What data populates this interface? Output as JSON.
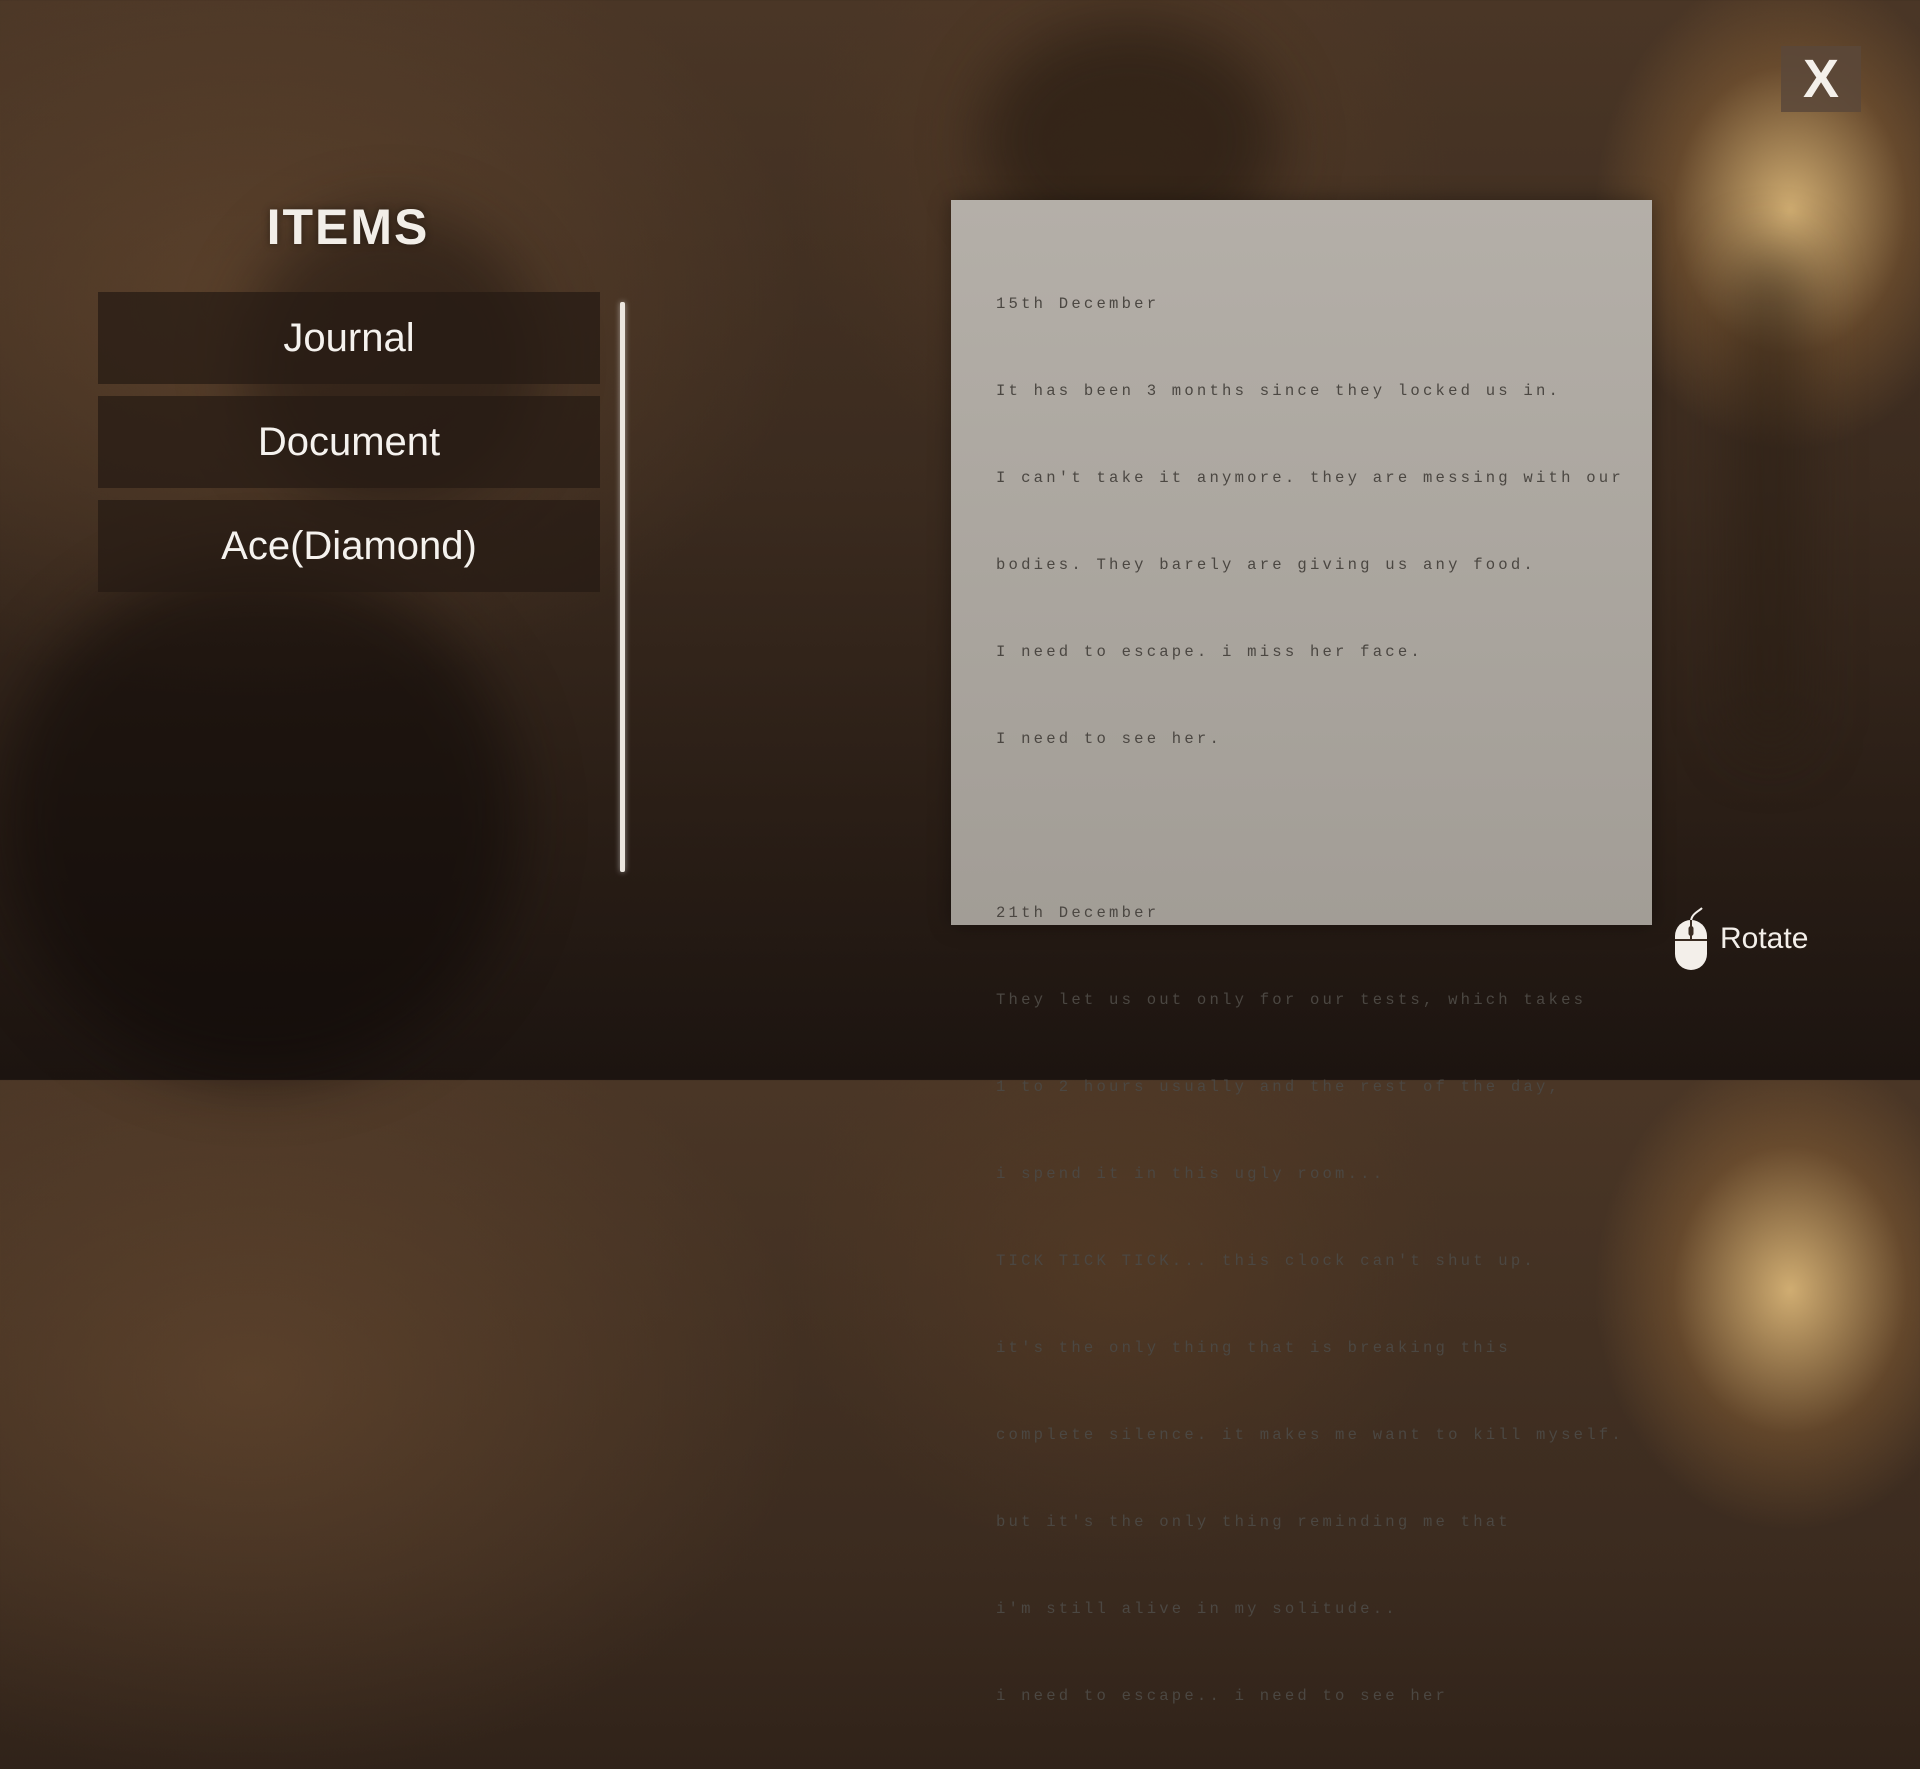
{
  "close_button": {
    "label": "X"
  },
  "inventory": {
    "title": "ITEMS",
    "items": [
      {
        "label": "Journal"
      },
      {
        "label": "Document"
      },
      {
        "label": "Ace(Diamond)"
      }
    ]
  },
  "document": {
    "entries": [
      {
        "date": "15th December",
        "lines": [
          "It has been 3 months since they locked us in.",
          "I can't take it anymore. they are messing with our",
          "bodies. They barely are giving us any food.",
          "I need to escape. i miss her face.",
          "I need to see her."
        ]
      },
      {
        "date": "21th December",
        "lines": [
          "They let us out only for our tests, which takes",
          "1 to 2 hours usually and the rest of the day,",
          "i spend it in this ugly room...",
          "TICK TICK TICK... this clock can't shut up.",
          "it's the only thing that is breaking this",
          "complete silence. it makes me want to kill myself.",
          "but it's the only thing reminding me that",
          "i'm still alive in my solitude..",
          "i need to escape.. i need to see her"
        ]
      }
    ]
  },
  "controls": {
    "rotate_label": "Rotate",
    "rotate_icon": "mouse-icon"
  }
}
